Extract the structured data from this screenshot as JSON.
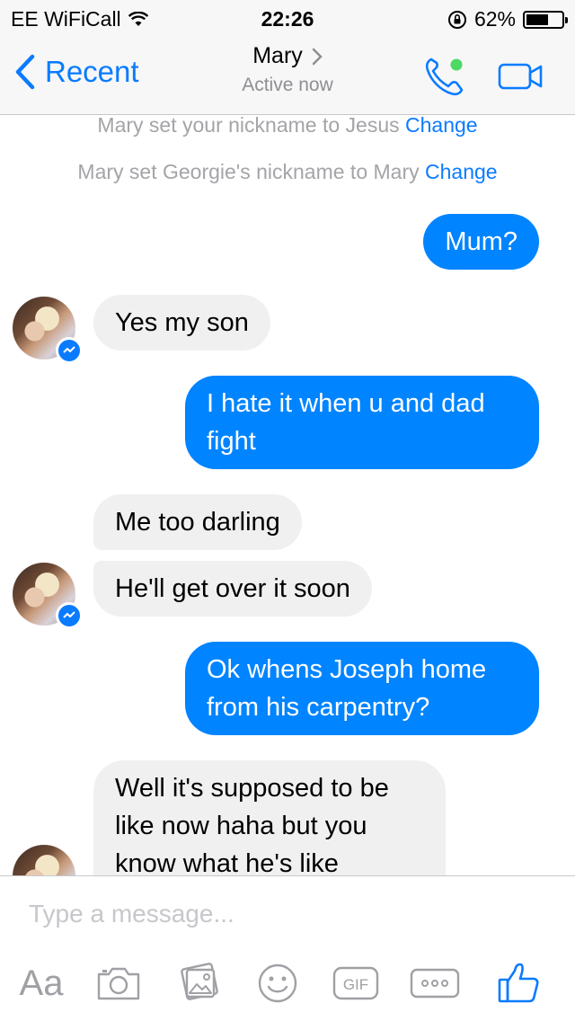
{
  "status_bar": {
    "carrier": "EE WiFiCall",
    "time": "22:26",
    "battery": "62%",
    "battery_level": 0.62
  },
  "nav": {
    "back_label": "Recent",
    "contact_name": "Mary",
    "contact_status": "Active now",
    "online_indicator_color": "#4cd964",
    "accent_color": "#0a7bff"
  },
  "system_messages": [
    {
      "text": "Mary set your nickname to Jesus",
      "action": "Change"
    },
    {
      "text": "Mary set Georgie's nickname to Mary",
      "action": "Change"
    }
  ],
  "messages": [
    {
      "direction": "out",
      "text": "Mum?"
    },
    {
      "direction": "in",
      "text": "Yes my son"
    },
    {
      "direction": "out",
      "text": "I hate it when u and dad fight"
    },
    {
      "direction": "in",
      "text": "Me too darling"
    },
    {
      "direction": "in",
      "text": "He'll get over it soon"
    },
    {
      "direction": "out",
      "text": "Ok whens Joseph home from his carpentry?"
    },
    {
      "direction": "in",
      "text": "Well it's supposed to be like now haha but you know what he's like"
    }
  ],
  "composer": {
    "placeholder": "Type a message...",
    "tools": [
      "text-style-icon",
      "camera-icon",
      "photo-icon",
      "emoji-icon",
      "gif-icon",
      "more-icon",
      "like-icon"
    ],
    "aa_label": "Aa",
    "gif_label": "GIF"
  },
  "colors": {
    "outgoing_bubble": "#0084ff",
    "incoming_bubble": "#f1f0f0"
  }
}
